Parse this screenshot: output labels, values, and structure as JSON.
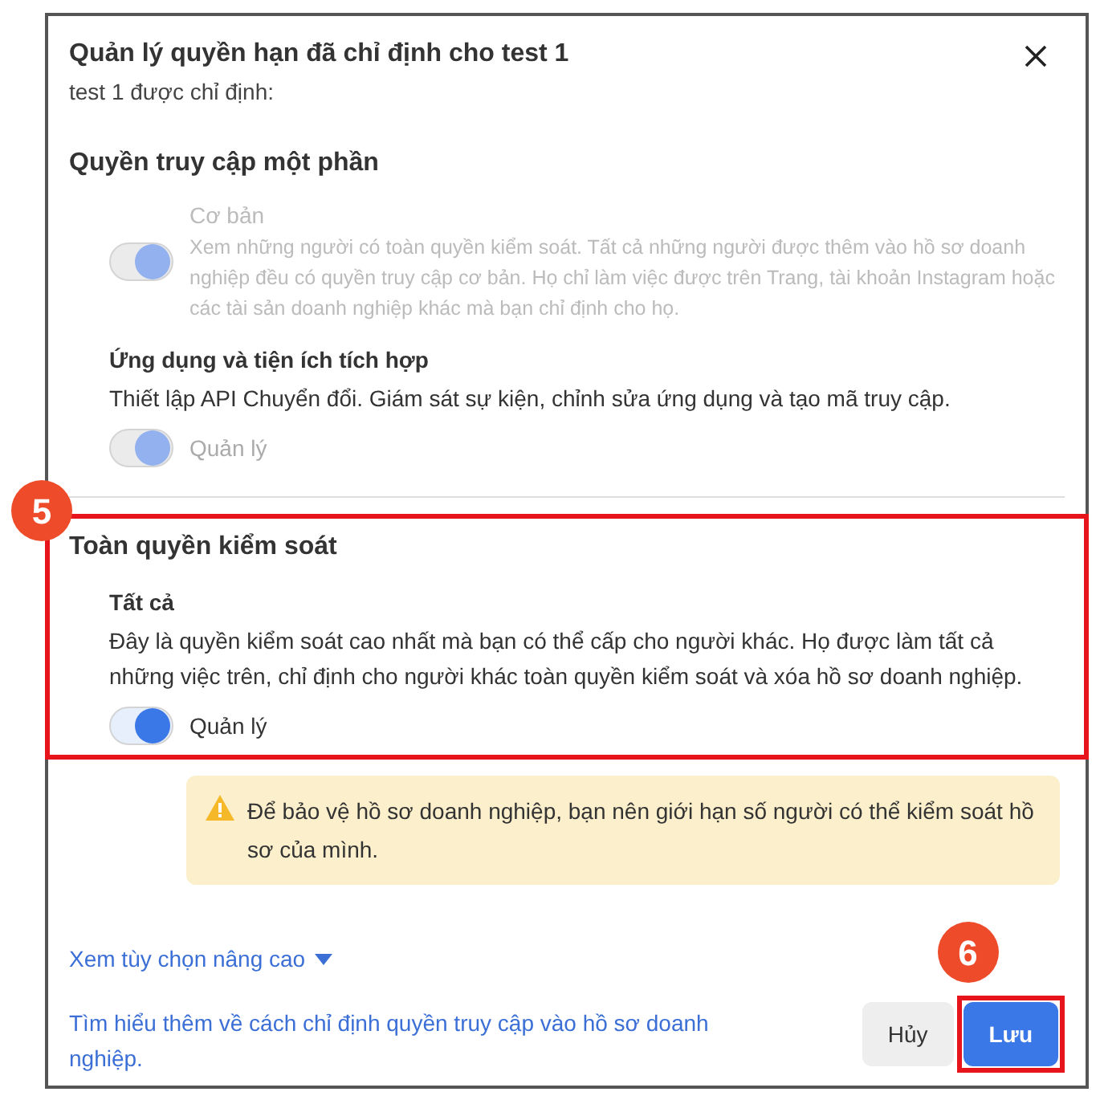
{
  "dialog": {
    "title": "Quản lý quyền hạn đã chỉ định cho test 1",
    "subtitle": "test 1 được chỉ định:"
  },
  "sections": [
    {
      "heading": "Quyền truy cập một phần",
      "highlighted": false,
      "permissions": [
        {
          "kind": "inline",
          "title": "Cơ bản",
          "description": "Xem những người có toàn quyền kiểm soát. Tất cả những người được thêm vào hồ sơ doanh nghiệp đều có quyền truy cập cơ bản. Họ chỉ làm việc được trên Trang, tài khoản Instagram hoặc các tài sản doanh nghiệp khác mà bạn chỉ định cho họ.",
          "toggle": {
            "on": true,
            "disabled": true
          }
        },
        {
          "kind": "stacked",
          "title": "Ứng dụng và tiện ích tích hợp",
          "description": "Thiết lập API Chuyển đổi. Giám sát sự kiện, chỉnh sửa ứng dụng và tạo mã truy cập.",
          "toggle": {
            "on": true,
            "disabled": true,
            "label": "Quản lý"
          }
        }
      ]
    },
    {
      "heading": "Toàn quyền kiểm soát",
      "highlighted": true,
      "callout": "5",
      "permissions": [
        {
          "kind": "stacked",
          "title": "Tất cả",
          "description": "Đây là quyền kiểm soát cao nhất mà bạn có thể cấp cho người khác. Họ được làm tất cả những việc trên, chỉ định cho người khác toàn quyền kiểm soát và xóa hồ sơ doanh nghiệp.",
          "toggle": {
            "on": true,
            "disabled": false,
            "label": "Quản lý"
          }
        }
      ]
    }
  ],
  "warning": "Để bảo vệ hồ sơ doanh nghiệp, bạn nên giới hạn số người có thể kiểm soát hồ sơ của mình.",
  "advanced_link": "Xem tùy chọn nâng cao",
  "learn_more_link": "Tìm hiểu thêm về cách chỉ định quyền truy cập vào hồ sơ doanh nghiệp.",
  "buttons": [
    {
      "label": "Hủy",
      "kind": "secondary",
      "highlighted": false
    },
    {
      "label": "Lưu",
      "kind": "primary",
      "highlighted": true,
      "callout": "6"
    }
  ]
}
